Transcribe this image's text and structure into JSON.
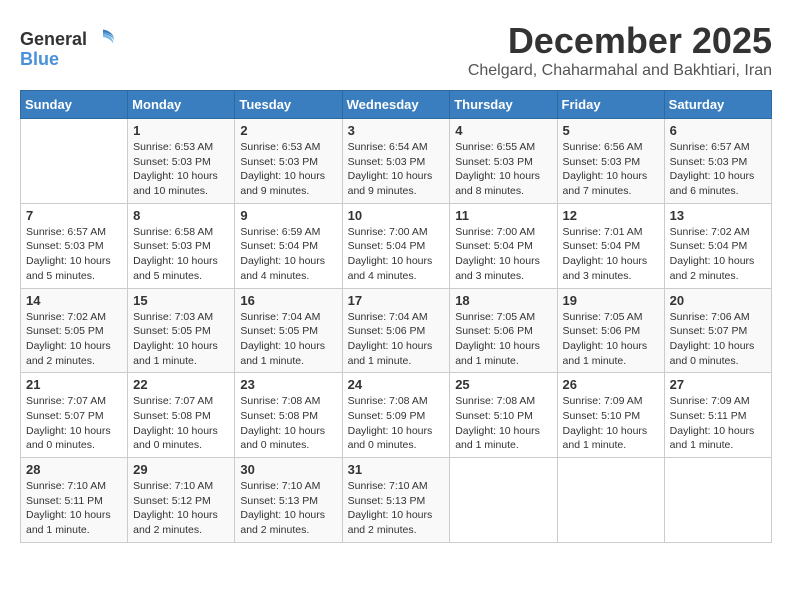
{
  "logo": {
    "general": "General",
    "blue": "Blue"
  },
  "title": "December 2025",
  "subtitle": "Chelgard, Chaharmahal and Bakhtiari, Iran",
  "weekdays": [
    "Sunday",
    "Monday",
    "Tuesday",
    "Wednesday",
    "Thursday",
    "Friday",
    "Saturday"
  ],
  "weeks": [
    [
      {
        "day": "",
        "info": ""
      },
      {
        "day": "1",
        "info": "Sunrise: 6:53 AM\nSunset: 5:03 PM\nDaylight: 10 hours\nand 10 minutes."
      },
      {
        "day": "2",
        "info": "Sunrise: 6:53 AM\nSunset: 5:03 PM\nDaylight: 10 hours\nand 9 minutes."
      },
      {
        "day": "3",
        "info": "Sunrise: 6:54 AM\nSunset: 5:03 PM\nDaylight: 10 hours\nand 9 minutes."
      },
      {
        "day": "4",
        "info": "Sunrise: 6:55 AM\nSunset: 5:03 PM\nDaylight: 10 hours\nand 8 minutes."
      },
      {
        "day": "5",
        "info": "Sunrise: 6:56 AM\nSunset: 5:03 PM\nDaylight: 10 hours\nand 7 minutes."
      },
      {
        "day": "6",
        "info": "Sunrise: 6:57 AM\nSunset: 5:03 PM\nDaylight: 10 hours\nand 6 minutes."
      }
    ],
    [
      {
        "day": "7",
        "info": "Sunrise: 6:57 AM\nSunset: 5:03 PM\nDaylight: 10 hours\nand 5 minutes."
      },
      {
        "day": "8",
        "info": "Sunrise: 6:58 AM\nSunset: 5:03 PM\nDaylight: 10 hours\nand 5 minutes."
      },
      {
        "day": "9",
        "info": "Sunrise: 6:59 AM\nSunset: 5:04 PM\nDaylight: 10 hours\nand 4 minutes."
      },
      {
        "day": "10",
        "info": "Sunrise: 7:00 AM\nSunset: 5:04 PM\nDaylight: 10 hours\nand 4 minutes."
      },
      {
        "day": "11",
        "info": "Sunrise: 7:00 AM\nSunset: 5:04 PM\nDaylight: 10 hours\nand 3 minutes."
      },
      {
        "day": "12",
        "info": "Sunrise: 7:01 AM\nSunset: 5:04 PM\nDaylight: 10 hours\nand 3 minutes."
      },
      {
        "day": "13",
        "info": "Sunrise: 7:02 AM\nSunset: 5:04 PM\nDaylight: 10 hours\nand 2 minutes."
      }
    ],
    [
      {
        "day": "14",
        "info": "Sunrise: 7:02 AM\nSunset: 5:05 PM\nDaylight: 10 hours\nand 2 minutes."
      },
      {
        "day": "15",
        "info": "Sunrise: 7:03 AM\nSunset: 5:05 PM\nDaylight: 10 hours\nand 1 minute."
      },
      {
        "day": "16",
        "info": "Sunrise: 7:04 AM\nSunset: 5:05 PM\nDaylight: 10 hours\nand 1 minute."
      },
      {
        "day": "17",
        "info": "Sunrise: 7:04 AM\nSunset: 5:06 PM\nDaylight: 10 hours\nand 1 minute."
      },
      {
        "day": "18",
        "info": "Sunrise: 7:05 AM\nSunset: 5:06 PM\nDaylight: 10 hours\nand 1 minute."
      },
      {
        "day": "19",
        "info": "Sunrise: 7:05 AM\nSunset: 5:06 PM\nDaylight: 10 hours\nand 1 minute."
      },
      {
        "day": "20",
        "info": "Sunrise: 7:06 AM\nSunset: 5:07 PM\nDaylight: 10 hours\nand 0 minutes."
      }
    ],
    [
      {
        "day": "21",
        "info": "Sunrise: 7:07 AM\nSunset: 5:07 PM\nDaylight: 10 hours\nand 0 minutes."
      },
      {
        "day": "22",
        "info": "Sunrise: 7:07 AM\nSunset: 5:08 PM\nDaylight: 10 hours\nand 0 minutes."
      },
      {
        "day": "23",
        "info": "Sunrise: 7:08 AM\nSunset: 5:08 PM\nDaylight: 10 hours\nand 0 minutes."
      },
      {
        "day": "24",
        "info": "Sunrise: 7:08 AM\nSunset: 5:09 PM\nDaylight: 10 hours\nand 0 minutes."
      },
      {
        "day": "25",
        "info": "Sunrise: 7:08 AM\nSunset: 5:10 PM\nDaylight: 10 hours\nand 1 minute."
      },
      {
        "day": "26",
        "info": "Sunrise: 7:09 AM\nSunset: 5:10 PM\nDaylight: 10 hours\nand 1 minute."
      },
      {
        "day": "27",
        "info": "Sunrise: 7:09 AM\nSunset: 5:11 PM\nDaylight: 10 hours\nand 1 minute."
      }
    ],
    [
      {
        "day": "28",
        "info": "Sunrise: 7:10 AM\nSunset: 5:11 PM\nDaylight: 10 hours\nand 1 minute."
      },
      {
        "day": "29",
        "info": "Sunrise: 7:10 AM\nSunset: 5:12 PM\nDaylight: 10 hours\nand 2 minutes."
      },
      {
        "day": "30",
        "info": "Sunrise: 7:10 AM\nSunset: 5:13 PM\nDaylight: 10 hours\nand 2 minutes."
      },
      {
        "day": "31",
        "info": "Sunrise: 7:10 AM\nSunset: 5:13 PM\nDaylight: 10 hours\nand 2 minutes."
      },
      {
        "day": "",
        "info": ""
      },
      {
        "day": "",
        "info": ""
      },
      {
        "day": "",
        "info": ""
      }
    ]
  ]
}
